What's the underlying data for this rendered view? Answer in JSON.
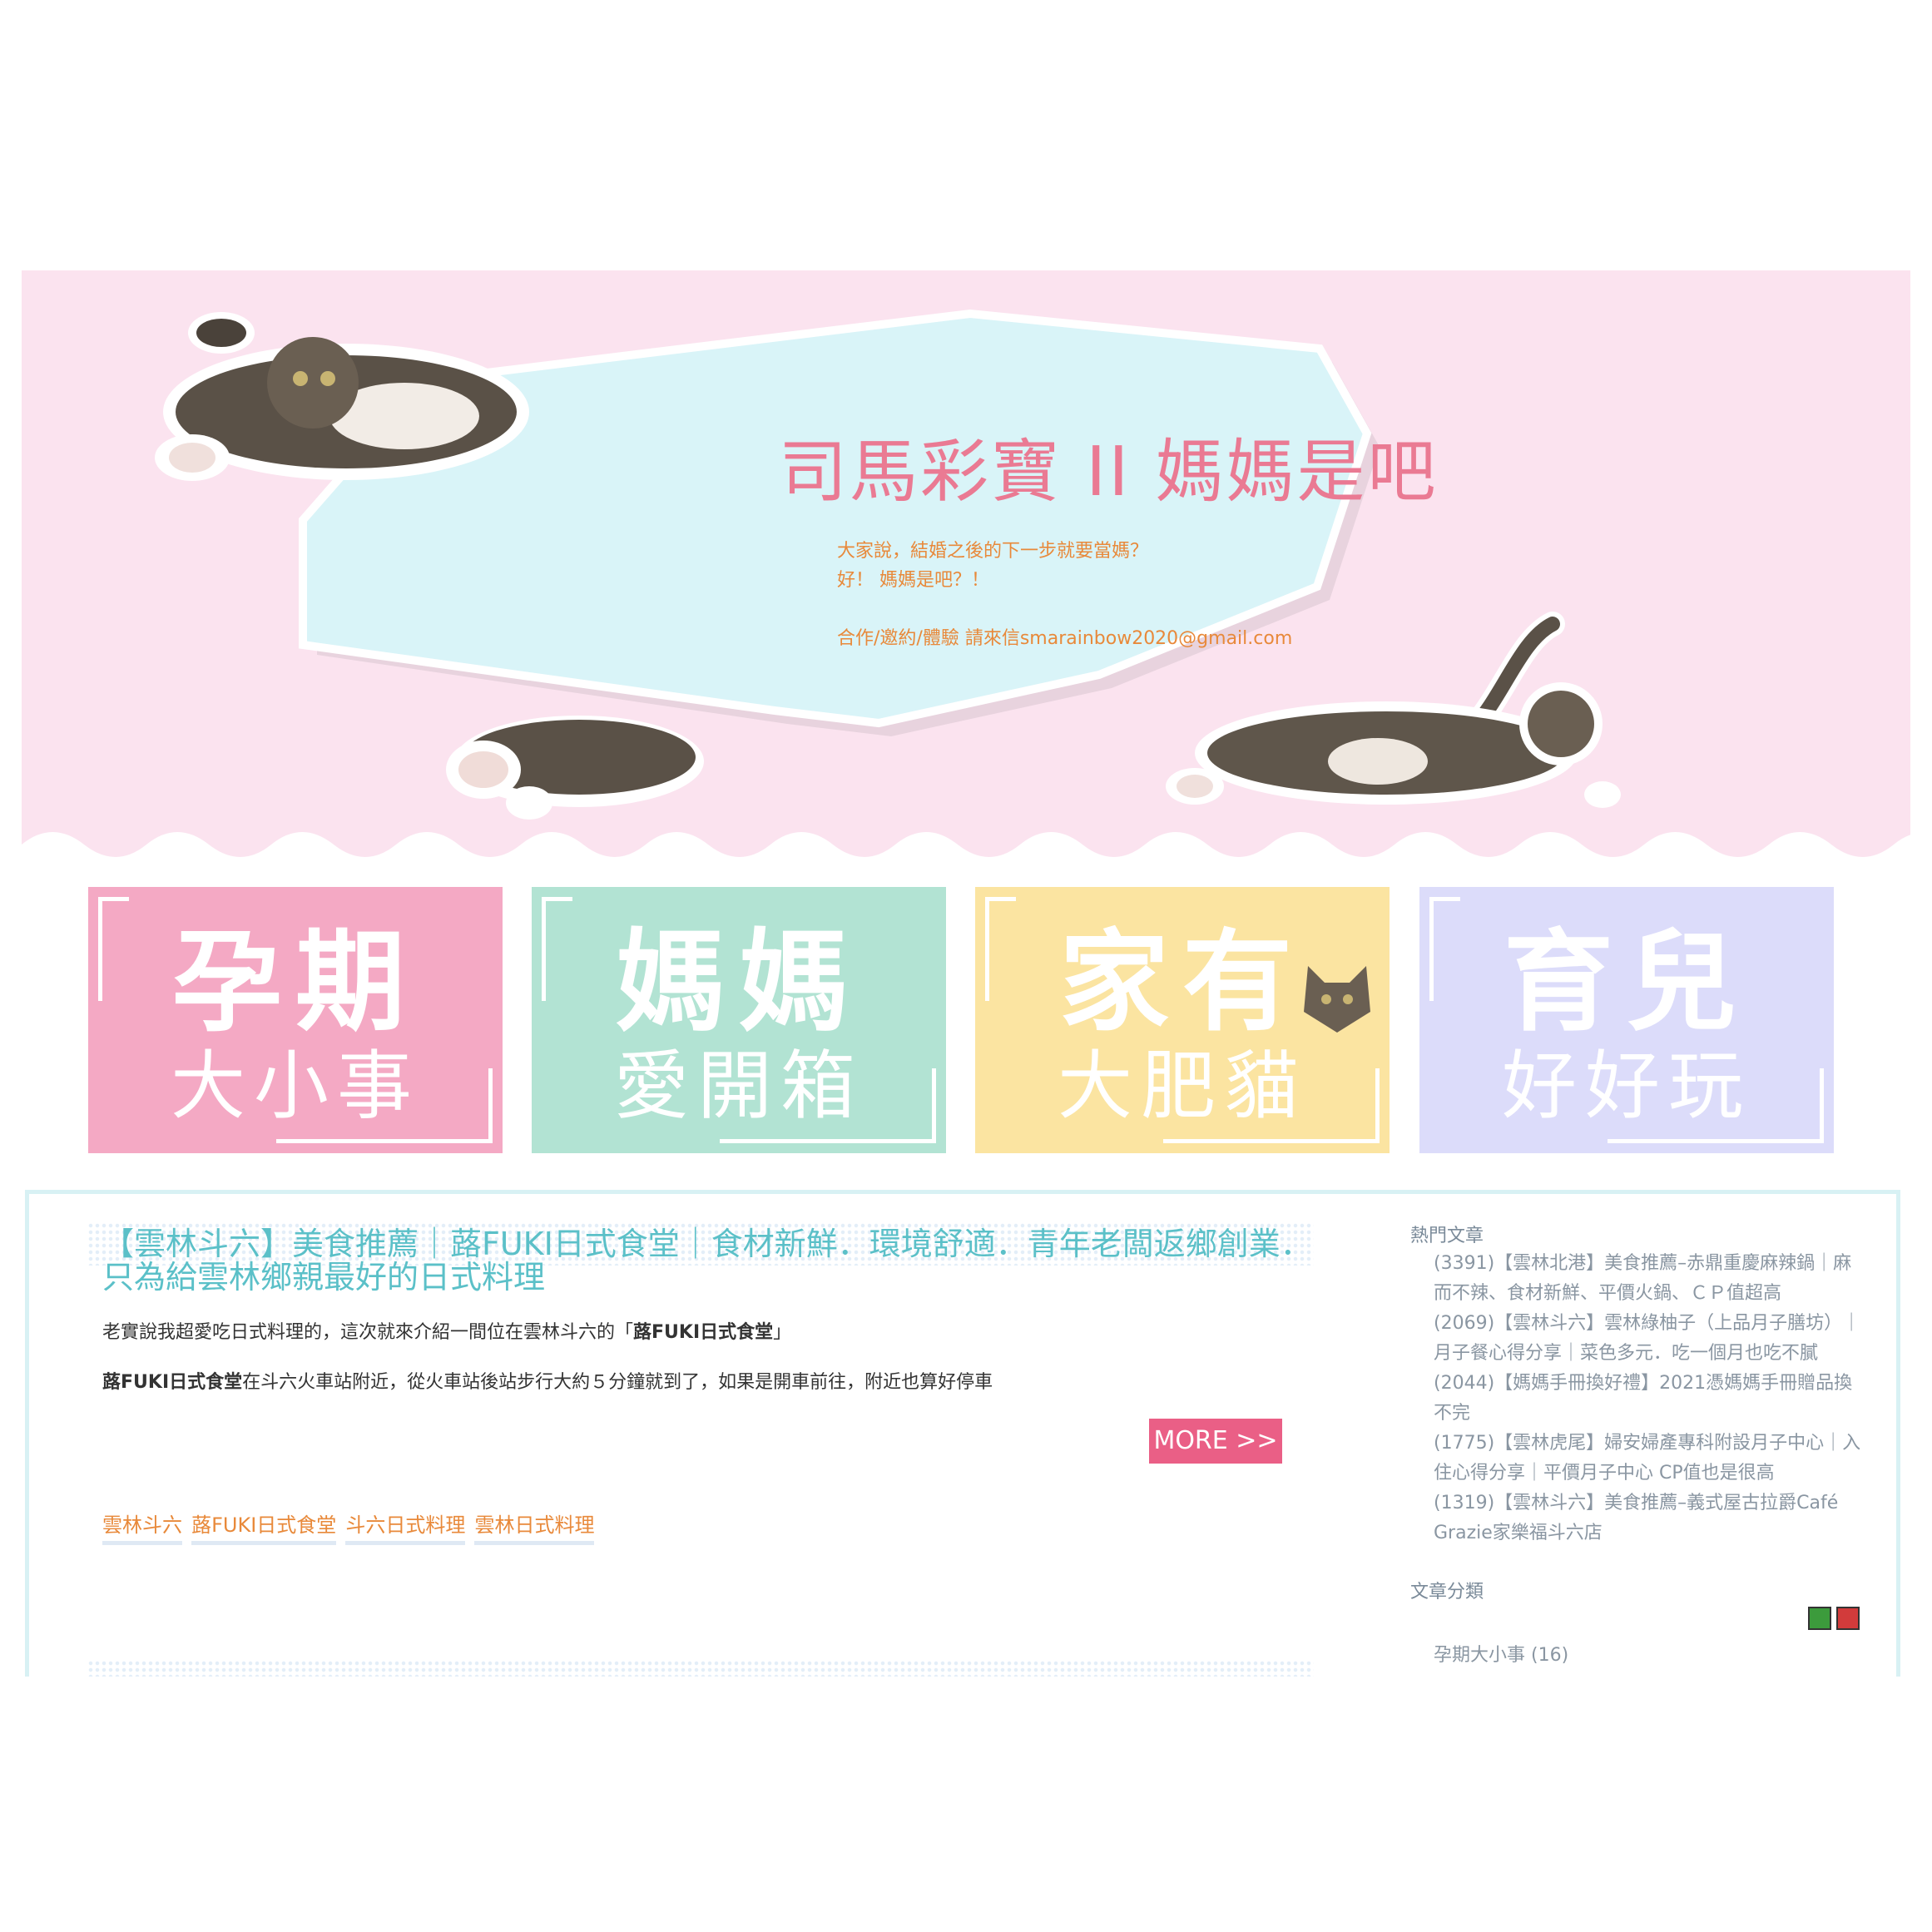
{
  "header": {
    "title": "司馬彩寶 II 媽媽是吧",
    "desc_line1": "大家說，結婚之後的下一步就要當媽？",
    "desc_line2": "好！ 媽媽是吧？！",
    "desc_line3": "合作/邀約/體驗 請來信smarainbow2020@gmail.com"
  },
  "tiles": [
    {
      "big": "孕期",
      "small": "大小事",
      "color": "#f4a9c4"
    },
    {
      "big": "媽媽",
      "small": "愛開箱",
      "color": "#b2e3d3"
    },
    {
      "big": "家有",
      "small": "大肥貓",
      "color": "#fbe4a1"
    },
    {
      "big": "育兒",
      "small": "好好玩",
      "color": "#dcdcfa"
    }
  ],
  "post": {
    "title": "【雲林斗六】美食推薦｜蕗FUKI日式食堂｜食材新鮮．環境舒適．青年老闆返鄉創業．只為給雲林鄉親最好的日式料理",
    "p1_text": "老實說我超愛吃日式料理的，這次就來介紹一間位在雲林斗六的「",
    "p1_bold": "蕗FUKI日式食堂",
    "p1_end": "」",
    "p2_bold": "蕗FUKI日式食堂",
    "p2_text": "在斗六火車站附近，從火車站後站步行大約５分鐘就到了，如果是開車前往，附近也算好停車",
    "more_label": "MORE >>",
    "tags": [
      "雲林斗六",
      "蕗FUKI日式食堂",
      "斗六日式料理",
      "雲林日式料理"
    ]
  },
  "sidebar": {
    "popular_heading": "熱門文章",
    "popular": [
      "(3391)【雲林北港】美食推薦–赤鼎重慶麻辣鍋｜麻而不辣、食材新鮮、平價火鍋、ＣＰ值超高",
      "(2069)【雲林斗六】雲林綠柚子（上品月子膳坊）｜月子餐心得分享｜菜色多元．吃一個月也吃不膩",
      "(2044)【媽媽手冊換好禮】2021憑媽媽手冊贈品換不完",
      "(1775)【雲林虎尾】婦安婦產專科附設月子中心｜入住心得分享｜平價月子中心 CP值也是很高",
      "(1319)【雲林斗六】美食推薦–義式屋古拉爵Café Grazie家樂福斗六店"
    ],
    "category_heading": "文章分類",
    "category_item": "孕期大小事 (16)"
  },
  "colors": {
    "banner_bg": "#fbe3ef",
    "panel": "#d9f4f8",
    "title": "#ea7a93",
    "accent_orange": "#e8893a",
    "more_button": "#ea5f86",
    "post_title": "#5bc0c8"
  }
}
